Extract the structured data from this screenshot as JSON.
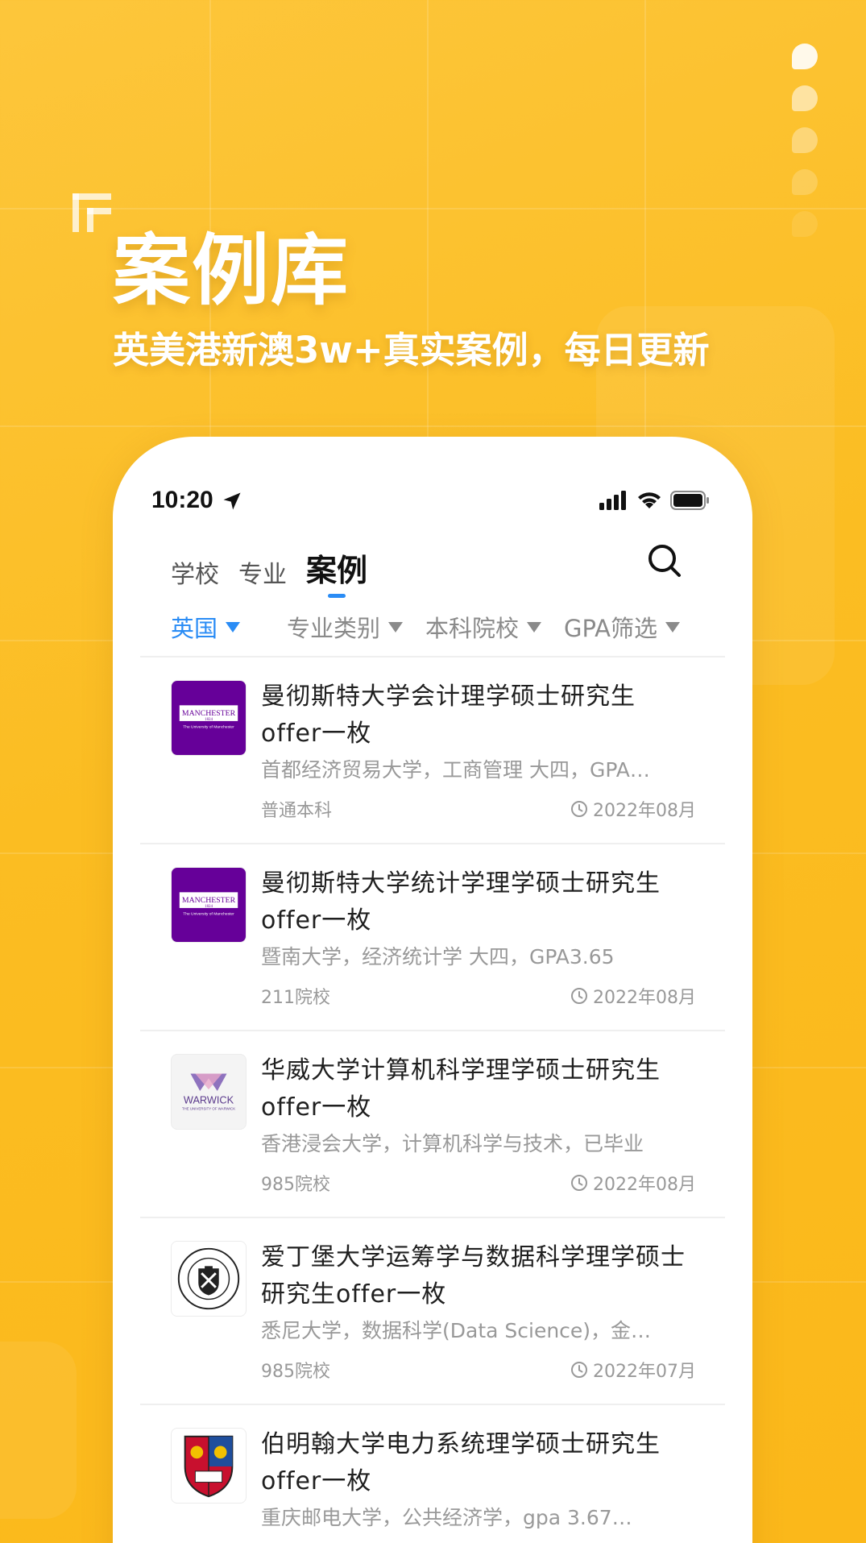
{
  "hero": {
    "title": "案例库",
    "subtitle": "英美港新澳3w+真实案例，每日更新"
  },
  "status_bar": {
    "time": "10:20"
  },
  "tabs": [
    {
      "label": "学校",
      "active": false
    },
    {
      "label": "专业",
      "active": false
    },
    {
      "label": "案例",
      "active": true
    }
  ],
  "filters": [
    {
      "label": "英国",
      "active": true
    },
    {
      "label": "专业类别",
      "active": false
    },
    {
      "label": "本科院校",
      "active": false
    },
    {
      "label": "GPA筛选",
      "active": false
    }
  ],
  "cases": [
    {
      "logo": "manchester-logo",
      "title": "曼彻斯特大学会计理学硕士研究生offer一枚",
      "desc": "首都经济贸易大学，工商管理 大四，GPA…",
      "tag": "普通本科",
      "date": "2022年08月"
    },
    {
      "logo": "manchester-logo",
      "title": "曼彻斯特大学统计学理学硕士研究生offer一枚",
      "desc": "暨南大学，经济统计学 大四，GPA3.65",
      "tag": "211院校",
      "date": "2022年08月"
    },
    {
      "logo": "warwick-logo",
      "title": "华威大学计算机科学理学硕士研究生offer一枚",
      "desc": "香港浸会大学，计算机科学与技术，已毕业",
      "tag": "985院校",
      "date": "2022年08月"
    },
    {
      "logo": "edinburgh-logo",
      "title": "爱丁堡大学运筹学与数据科学理学硕士研究生offer一枚",
      "desc": "悉尼大学，数据科学(Data Science)，金…",
      "tag": "985院校",
      "date": "2022年07月"
    },
    {
      "logo": "birmingham-logo",
      "title": "伯明翰大学电力系统理学硕士研究生offer一枚",
      "desc": "重庆邮电大学，公共经济学，gpa 3.67…",
      "tag": "",
      "date": ""
    }
  ],
  "logo_text": {
    "manchester": "MANCHESTER",
    "manchester_year": "1824",
    "manchester_sub": "The University of Manchester",
    "warwick": "WARWICK",
    "warwick_sub": "THE UNIVERSITY OF WARWICK"
  },
  "colors": {
    "background": "#fbbd22",
    "accent": "#2a8cf5",
    "manchester_purple": "#660099",
    "warwick_purple": "#5b3a8c"
  }
}
